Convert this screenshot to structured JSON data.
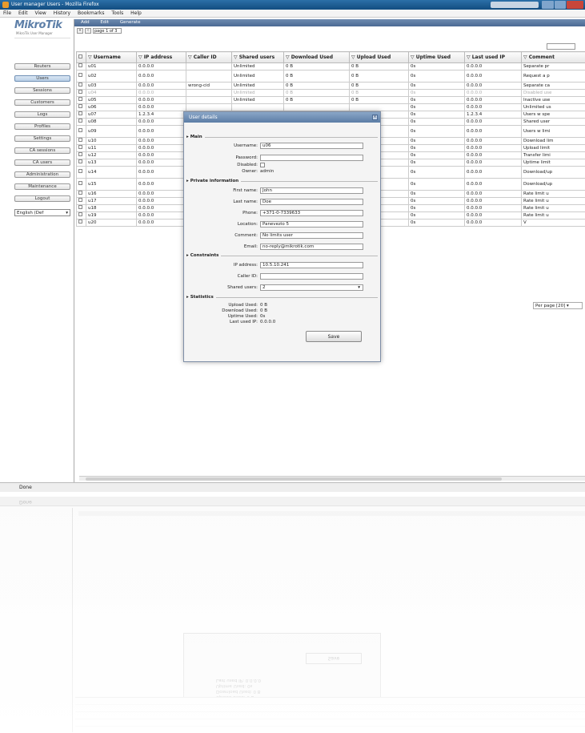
{
  "window": {
    "title": "User manager Users - Mozilla Firefox"
  },
  "menu": [
    "File",
    "Edit",
    "View",
    "History",
    "Bookmarks",
    "Tools",
    "Help"
  ],
  "logo": {
    "brand": "MikroTik",
    "sub": "MikroTik User Manager"
  },
  "sidebar": {
    "items": [
      {
        "label": "Routers"
      },
      {
        "label": "Users",
        "active": true
      },
      {
        "label": "Sessions"
      },
      {
        "label": "Customers"
      },
      {
        "label": "Logs"
      },
      {
        "label": "Profiles"
      },
      {
        "label": "Settings"
      },
      {
        "label": "CA sessions"
      },
      {
        "label": "CA users"
      },
      {
        "label": "Administration"
      },
      {
        "label": "Maintenance"
      },
      {
        "label": "Logout"
      }
    ],
    "language": "English (Def"
  },
  "toolbar": {
    "tabs": [
      "Add",
      "Edit",
      "Generate"
    ]
  },
  "pager": {
    "text": "page 1 of 3"
  },
  "table": {
    "columns": [
      "Username",
      "IP address",
      "Caller ID",
      "Shared users",
      "Download Used",
      "Upload Used",
      "Uptime Used",
      "Last used IP",
      "Comment"
    ],
    "rows": [
      {
        "u": "u01",
        "ip": "0.0.0.0",
        "cid": "",
        "su": "Unlimited",
        "dl": "0 B",
        "ul": "0 B",
        "up": "0s",
        "lip": "0.0.0.0",
        "c": "Separate pr",
        "tall": false,
        "dim": false
      },
      {
        "u": "u02",
        "ip": "0.0.0.0",
        "cid": "",
        "su": "Unlimited",
        "dl": "0 B",
        "ul": "0 B",
        "up": "0s",
        "lip": "0.0.0.0",
        "c": "Request a p",
        "tall": true,
        "dim": false
      },
      {
        "u": "u03",
        "ip": "0.0.0.0",
        "cid": "wrong-cid",
        "su": "Unlimited",
        "dl": "0 B",
        "ul": "0 B",
        "up": "0s",
        "lip": "0.0.0.0",
        "c": "Separate ca",
        "tall": false,
        "dim": false
      },
      {
        "u": "u04",
        "ip": "0.0.0.0",
        "cid": "",
        "su": "Unlimited",
        "dl": "0 B",
        "ul": "0 B",
        "up": "0s",
        "lip": "0.0.0.0",
        "c": "Disabled use",
        "tall": false,
        "dim": true
      },
      {
        "u": "u05",
        "ip": "0.0.0.0",
        "cid": "",
        "su": "Unlimited",
        "dl": "0 B",
        "ul": "0 B",
        "up": "0s",
        "lip": "0.0.0.0",
        "c": "Inactive use",
        "tall": false,
        "dim": false
      },
      {
        "u": "u06",
        "ip": "0.0.0.0",
        "cid": "",
        "su": "",
        "dl": "",
        "ul": "",
        "up": "0s",
        "lip": "0.0.0.0",
        "c": "Unlimited us",
        "tall": false,
        "dim": false
      },
      {
        "u": "u07",
        "ip": "1.2.3.4",
        "cid": "",
        "su": "",
        "dl": "",
        "ul": "",
        "up": "0s",
        "lip": "1.2.3.4",
        "c": "Users w spe",
        "tall": false,
        "dim": false
      },
      {
        "u": "u08",
        "ip": "0.0.0.0",
        "cid": "",
        "su": "",
        "dl": "",
        "ul": "",
        "up": "0s",
        "lip": "0.0.0.0",
        "c": "Shared user",
        "tall": false,
        "dim": false
      },
      {
        "u": "u09",
        "ip": "0.0.0.0",
        "cid": "",
        "su": "",
        "dl": "",
        "ul": "",
        "up": "0s",
        "lip": "0.0.0.0",
        "c": "Users w limi",
        "tall": true,
        "dim": false
      },
      {
        "u": "u10",
        "ip": "0.0.0.0",
        "cid": "",
        "su": "",
        "dl": "",
        "ul": "",
        "up": "0s",
        "lip": "0.0.0.0",
        "c": "Download lim",
        "tall": false,
        "dim": false
      },
      {
        "u": "u11",
        "ip": "0.0.0.0",
        "cid": "",
        "su": "",
        "dl": "",
        "ul": "",
        "up": "0s",
        "lip": "0.0.0.0",
        "c": "Upload limit",
        "tall": false,
        "dim": false
      },
      {
        "u": "u12",
        "ip": "0.0.0.0",
        "cid": "",
        "su": "",
        "dl": "",
        "ul": "",
        "up": "0s",
        "lip": "0.0.0.0",
        "c": "Transfer limi",
        "tall": false,
        "dim": false
      },
      {
        "u": "u13",
        "ip": "0.0.0.0",
        "cid": "",
        "su": "",
        "dl": "",
        "ul": "",
        "up": "0s",
        "lip": "0.0.0.0",
        "c": "Uptime limit",
        "tall": false,
        "dim": false
      },
      {
        "u": "u14",
        "ip": "0.0.0.0",
        "cid": "",
        "su": "",
        "dl": "",
        "ul": "",
        "up": "0s",
        "lip": "0.0.0.0",
        "c": "Download/up",
        "tall": true,
        "dim": false
      },
      {
        "u": "u15",
        "ip": "0.0.0.0",
        "cid": "",
        "su": "",
        "dl": "",
        "ul": "",
        "up": "0s",
        "lip": "0.0.0.0",
        "c": "Download/up",
        "tall": true,
        "dim": false
      },
      {
        "u": "u16",
        "ip": "0.0.0.0",
        "cid": "",
        "su": "",
        "dl": "",
        "ul": "",
        "up": "0s",
        "lip": "0.0.0.0",
        "c": "Rate limit u",
        "tall": false,
        "dim": false
      },
      {
        "u": "u17",
        "ip": "0.0.0.0",
        "cid": "",
        "su": "",
        "dl": "",
        "ul": "",
        "up": "0s",
        "lip": "0.0.0.0",
        "c": "Rate limit u",
        "tall": false,
        "dim": false
      },
      {
        "u": "u18",
        "ip": "0.0.0.0",
        "cid": "",
        "su": "",
        "dl": "",
        "ul": "",
        "up": "0s",
        "lip": "0.0.0.0",
        "c": "Rate limit u",
        "tall": false,
        "dim": false
      },
      {
        "u": "u19",
        "ip": "0.0.0.0",
        "cid": "",
        "su": "",
        "dl": "",
        "ul": "",
        "up": "0s",
        "lip": "0.0.0.0",
        "c": "Rate limit u",
        "tall": false,
        "dim": false
      },
      {
        "u": "u20",
        "ip": "0.0.0.0",
        "cid": "",
        "su": "",
        "dl": "",
        "ul": "",
        "up": "0s",
        "lip": "0.0.0.0",
        "c": "V",
        "tall": false,
        "dim": false
      }
    ],
    "per_page": "Per page [20]"
  },
  "dialog": {
    "title": "User details",
    "main_legend": "Main",
    "username_label": "Username:",
    "username": "u06",
    "password_label": "Password:",
    "disabled_label": "Disabled:",
    "owner_label": "Owner:",
    "owner": "admin",
    "private_legend": "Private information",
    "firstname_label": "First name:",
    "firstname": "John",
    "lastname_label": "Last name:",
    "lastname": "Doe",
    "phone_label": "Phone:",
    "phone": "+371-0-7339633",
    "location_label": "Location:",
    "location": "Panevezio 5",
    "comment_label": "Comment:",
    "comment": "No limits user",
    "email_label": "Email:",
    "email": "no-reply@mikrotik.com",
    "constraints_legend": "Constraints",
    "ip_label": "IP address:",
    "ip": "10.5.10.241",
    "callerid_label": "Caller ID:",
    "callerid": "",
    "shared_label": "Shared users:",
    "shared": "2",
    "stats_legend": "Statistics",
    "upload_label": "Upload Used:",
    "upload": "0 B",
    "download_label": "Download Used:",
    "download": "0 B",
    "uptime_label": "Uptime Used:",
    "uptime": "0s",
    "lastip_label": "Last used IP:",
    "lastip": "0.0.0.0",
    "save_label": "Save"
  },
  "status": {
    "text": "Done"
  }
}
